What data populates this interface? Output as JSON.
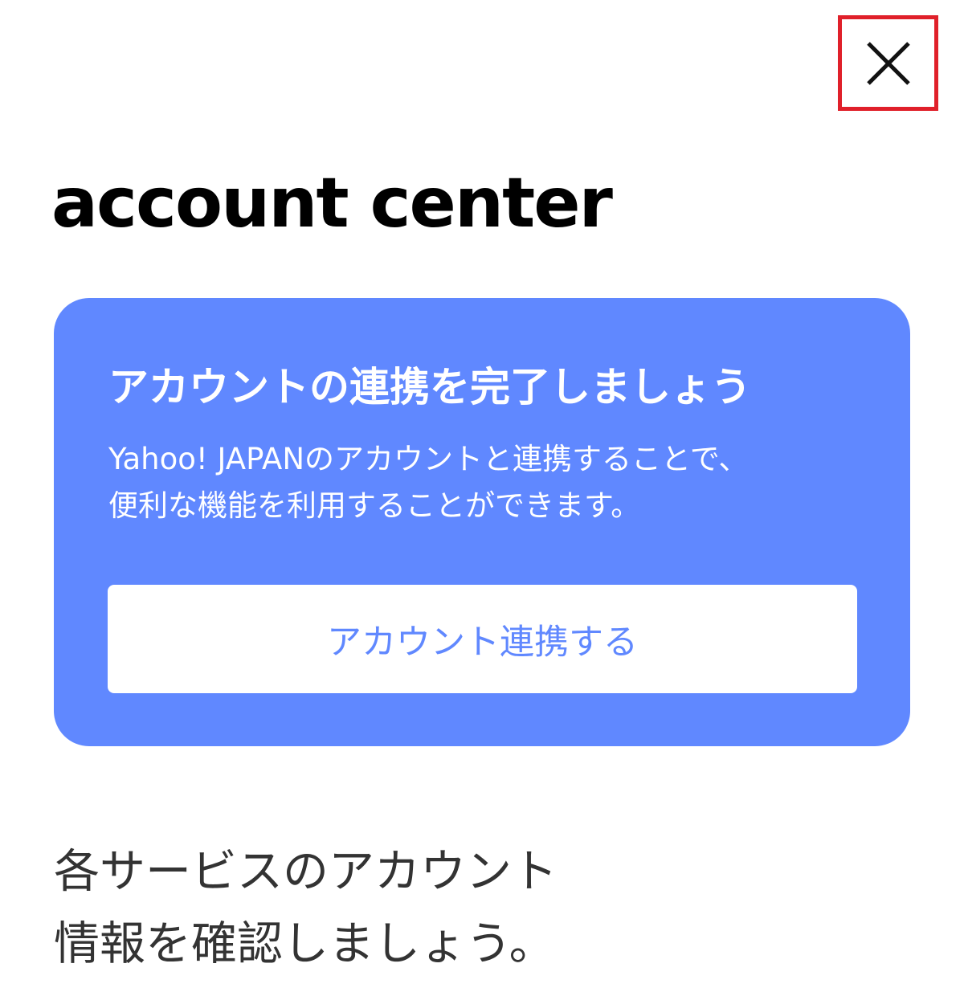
{
  "header": {
    "close_icon": "close-icon",
    "close_highlight_color": "#e0202a"
  },
  "brand": {
    "logo_text": "account center"
  },
  "link_card": {
    "title": "アカウントの連携を完了しましょう",
    "description_line1": "Yahoo! JAPANのアカウントと連携することで、",
    "description_line2": "便利な機能を利用することができます。",
    "button_label": "アカウント連携する",
    "background_color": "#6088ff",
    "button_text_color": "#6088ff"
  },
  "info": {
    "line1": "各サービスのアカウント",
    "line2": "情報を確認しましょう。"
  }
}
